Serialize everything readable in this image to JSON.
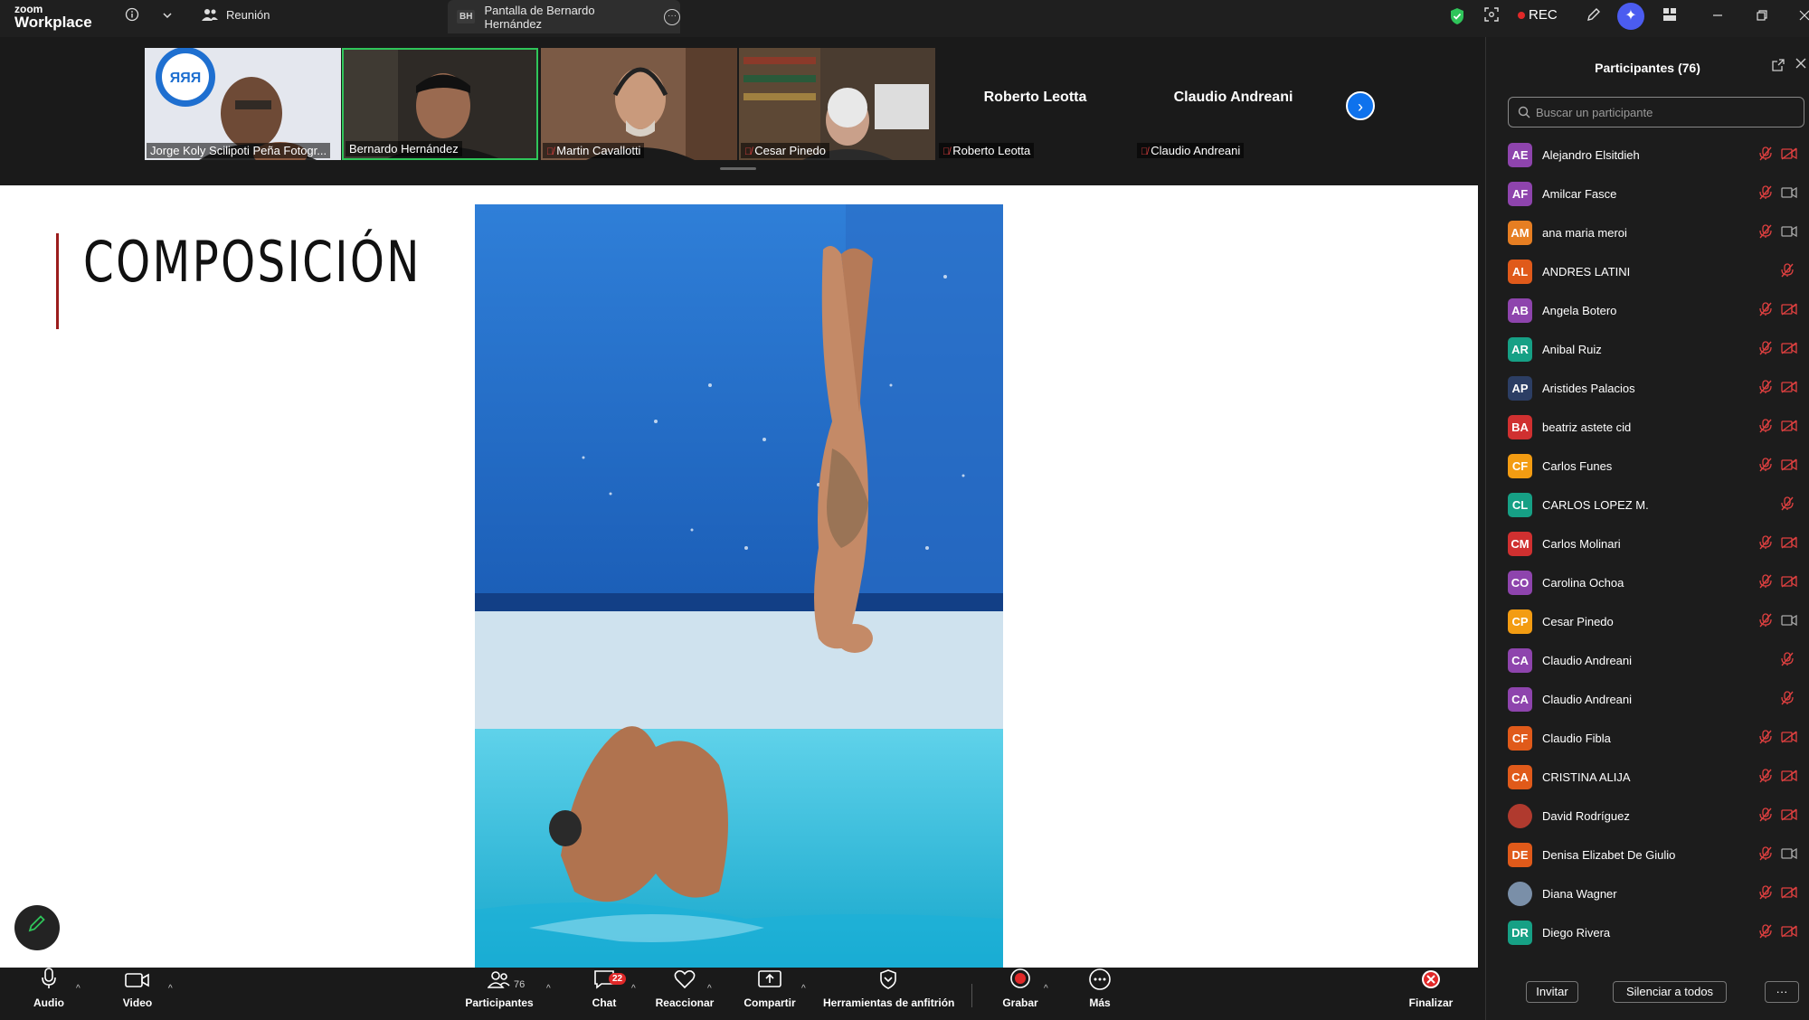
{
  "titlebar": {
    "logo_line1": "zoom",
    "logo_line2": "Workplace",
    "meeting_label": "Reunión",
    "share_badge": "BH",
    "share_tab_label": "Pantalla de Bernardo Hernández",
    "rec_label": "REC",
    "icons": [
      "info-icon",
      "chevron-down-icon",
      "shield-check-icon",
      "fullscreen-icon",
      "pen-icon",
      "ai-companion-icon",
      "apps-icon",
      "minimize-icon",
      "restore-icon",
      "close-icon"
    ]
  },
  "video_strip": {
    "tiles": [
      {
        "name": "Jorge Koly Scilipoti Peña Fotogr...",
        "muted": false,
        "video": true
      },
      {
        "name": "Bernardo Hernández",
        "muted": false,
        "video": true,
        "active": true
      },
      {
        "name": "Martin Cavallotti",
        "muted": true,
        "video": true
      },
      {
        "name": "Cesar Pinedo",
        "muted": true,
        "video": true
      },
      {
        "name": "Roberto Leotta",
        "muted": true,
        "video": false,
        "big_name": "Roberto Leotta"
      },
      {
        "name": "Claudio Andreani",
        "muted": true,
        "video": false,
        "big_name": "Claudio Andreani"
      }
    ]
  },
  "slide": {
    "title": "COMPOSICIÓN",
    "logo_text": "ЯЯЯ"
  },
  "panel": {
    "title": "Participantes (76)",
    "search_placeholder": "Buscar un participante",
    "participants": [
      {
        "initials": "AE",
        "name": "Alejandro Elsitdieh",
        "color": "#8e44ad",
        "video_on": false,
        "has_video_icon": true
      },
      {
        "initials": "AF",
        "name": "Amilcar Fasce",
        "color": "#8e44ad",
        "video_on": true,
        "has_video_icon": true
      },
      {
        "initials": "AM",
        "name": "ana maria meroi",
        "color": "#e67e22",
        "video_on": true,
        "has_video_icon": true
      },
      {
        "initials": "AL",
        "name": "ANDRES LATINI",
        "color": "#e05a1a",
        "video_on": false,
        "has_video_icon": false
      },
      {
        "initials": "AB",
        "name": "Angela Botero",
        "color": "#8e44ad",
        "video_on": false,
        "has_video_icon": true
      },
      {
        "initials": "AR",
        "name": "Anibal Ruiz",
        "color": "#16a085",
        "video_on": false,
        "has_video_icon": true
      },
      {
        "initials": "AP",
        "name": "Aristides Palacios",
        "color": "#2c3e64",
        "video_on": false,
        "has_video_icon": true
      },
      {
        "initials": "BA",
        "name": "beatriz astete cid",
        "color": "#d03030",
        "video_on": false,
        "has_video_icon": true
      },
      {
        "initials": "CF",
        "name": "Carlos Funes",
        "color": "#f39c12",
        "video_on": false,
        "has_video_icon": true
      },
      {
        "initials": "CL",
        "name": "CARLOS LOPEZ M.",
        "color": "#16a085",
        "video_on": false,
        "has_video_icon": false
      },
      {
        "initials": "CM",
        "name": "Carlos Molinari",
        "color": "#d03030",
        "video_on": false,
        "has_video_icon": true
      },
      {
        "initials": "CO",
        "name": "Carolina Ochoa",
        "color": "#8e44ad",
        "video_on": false,
        "has_video_icon": true
      },
      {
        "initials": "CP",
        "name": "Cesar Pinedo",
        "color": "#f39c12",
        "video_on": true,
        "has_video_icon": true
      },
      {
        "initials": "CA",
        "name": "Claudio Andreani",
        "color": "#8e44ad",
        "video_on": false,
        "has_video_icon": false
      },
      {
        "initials": "CA",
        "name": "Claudio Andreani",
        "color": "#8e44ad",
        "video_on": false,
        "has_video_icon": false
      },
      {
        "initials": "CF",
        "name": "Claudio Fibla",
        "color": "#e05a1a",
        "video_on": false,
        "has_video_icon": true
      },
      {
        "initials": "CA",
        "name": "CRISTINA ALIJA",
        "color": "#e05a1a",
        "video_on": false,
        "has_video_icon": true
      },
      {
        "initials": "",
        "name": "David Rodríguez",
        "color": "#b03a2e",
        "video_on": false,
        "has_video_icon": true
      },
      {
        "initials": "DE",
        "name": "Denisa Elizabet De Giulio",
        "color": "#e05a1a",
        "video_on": true,
        "has_video_icon": true
      },
      {
        "initials": "",
        "name": "Diana Wagner",
        "color": "#7a8fa8",
        "video_on": false,
        "has_video_icon": true
      },
      {
        "initials": "DR",
        "name": "Diego Rivera",
        "color": "#16a085",
        "video_on": false,
        "has_video_icon": true
      }
    ],
    "invite_label": "Invitar",
    "mute_all_label": "Silenciar a todos",
    "more_label": "···"
  },
  "toolbar": {
    "audio_label": "Audio",
    "video_label": "Video",
    "participants_label": "Participantes",
    "participants_count": "76",
    "chat_label": "Chat",
    "chat_badge": "22",
    "react_label": "Reaccionar",
    "share_label": "Compartir",
    "host_tools_label": "Herramientas de anfitrión",
    "record_label": "Grabar",
    "more_label": "Más",
    "end_label": "Finalizar"
  }
}
